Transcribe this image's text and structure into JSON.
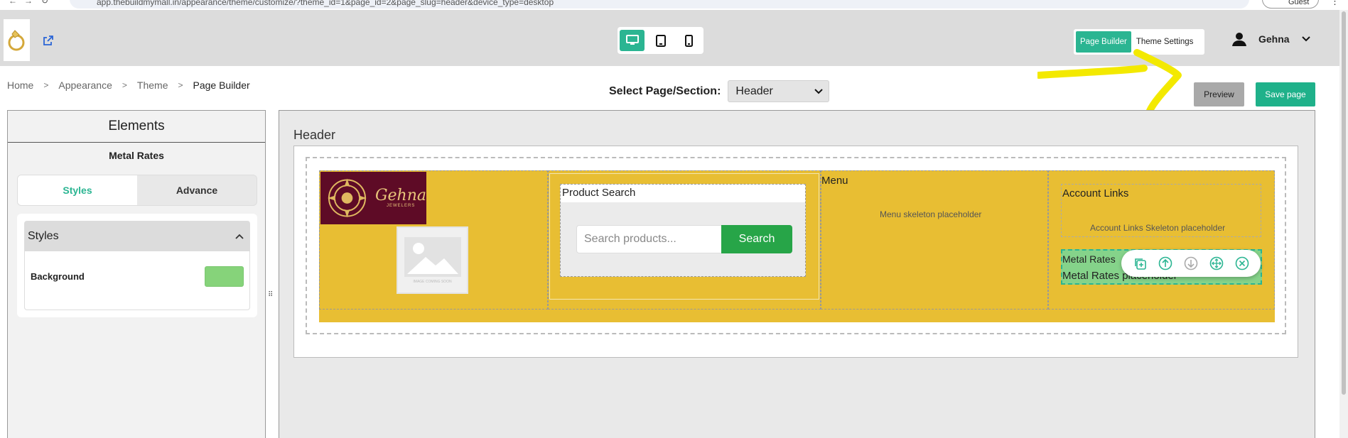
{
  "browser": {
    "url": "app.thebuildmymall.in/appearance/theme/customize/?theme_id=1&page_id=2&page_slug=header&device_type=desktop",
    "profile_label": "Guest"
  },
  "topbar": {
    "device_modes": [
      "desktop",
      "tablet",
      "mobile"
    ],
    "active_device": "desktop",
    "tabs": [
      {
        "label": "Page Builder"
      },
      {
        "label": "Theme Settings"
      }
    ],
    "user_name": "Gehna"
  },
  "breadcrumb": [
    {
      "label": "Home"
    },
    {
      "label": "Appearance"
    },
    {
      "label": "Theme"
    },
    {
      "label": "Page Builder"
    }
  ],
  "page_select": {
    "label": "Select Page/Section:",
    "value": "Header"
  },
  "actions": {
    "preview": "Preview",
    "save": "Save page"
  },
  "sidebar": {
    "title": "Elements",
    "selected_element": "Metal Rates",
    "tabs": [
      {
        "label": "Styles"
      },
      {
        "label": "Advance"
      }
    ],
    "panel_title": "Styles",
    "background_label": "Background",
    "background_color": "#86d37a"
  },
  "canvas": {
    "section_title": "Header",
    "logo": {
      "brand": "Gehna",
      "subtitle": "JEWELERS"
    },
    "image_placeholder_caption": "IMAGE COMING SOON",
    "product_search": {
      "label": "Product Search",
      "placeholder": "Search products...",
      "button": "Search"
    },
    "menu": {
      "label": "Menu",
      "placeholder": "Menu skeleton placeholder"
    },
    "account_links": {
      "label": "Account Links",
      "placeholder": "Account Links Skeleton placeholder"
    },
    "metal_rates": {
      "label": "Metal Rates",
      "placeholder": "Metal Rates placeholder"
    },
    "header_bg": "#e8be33",
    "accent": "#2bb592"
  }
}
